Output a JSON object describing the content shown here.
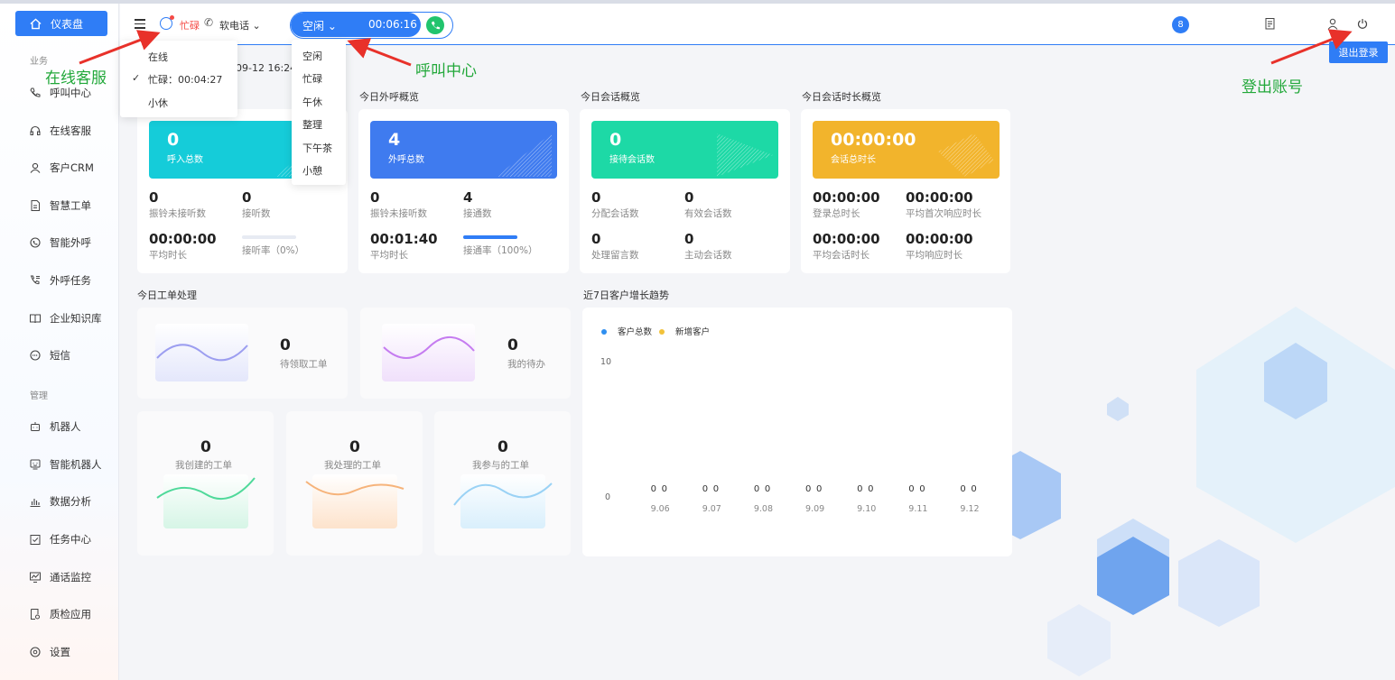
{
  "sidebar": {
    "dashboard_label": "仪表盘",
    "section_business": "业务",
    "section_manage": "管理",
    "business_items": [
      {
        "label": "呼叫中心",
        "icon": "phone-icon"
      },
      {
        "label": "在线客服",
        "icon": "headset-icon"
      },
      {
        "label": "客户CRM",
        "icon": "user-icon"
      },
      {
        "label": "智慧工单",
        "icon": "document-icon"
      },
      {
        "label": "智能外呼",
        "icon": "whatsapp-icon"
      },
      {
        "label": "外呼任务",
        "icon": "outbound-call-icon"
      },
      {
        "label": "企业知识库",
        "icon": "book-icon"
      },
      {
        "label": "短信",
        "icon": "sms-icon"
      }
    ],
    "manage_items": [
      {
        "label": "机器人",
        "icon": "robot-icon"
      },
      {
        "label": "智能机器人",
        "icon": "smart-robot-icon"
      },
      {
        "label": "数据分析",
        "icon": "bar-chart-icon"
      },
      {
        "label": "任务中心",
        "icon": "task-icon"
      },
      {
        "label": "通话监控",
        "icon": "monitor-icon"
      },
      {
        "label": "质检应用",
        "icon": "inspection-icon"
      },
      {
        "label": "设置",
        "icon": "settings-icon"
      }
    ]
  },
  "topbar": {
    "cs_status": "忙碌",
    "softphone_label": "软电话",
    "call_state": "空闲",
    "call_timer": "00:06:16",
    "notification_count": "8",
    "logout_label": "退出登录"
  },
  "cs_dropdown": {
    "items": [
      "在线",
      "忙碌：00:04:27",
      "小休"
    ],
    "checked_index": 1
  },
  "call_dropdown": {
    "items": [
      "空闲",
      "忙碌",
      "午休",
      "整理",
      "下午茶",
      "小憩"
    ]
  },
  "datetime_partial": "09-12 16:24",
  "cards": {
    "inbound": {
      "title": "",
      "hero_value": "0",
      "hero_label": "呼入总数",
      "color": "#15ccd9",
      "stats": [
        {
          "value": "0",
          "label": "振铃未接听数"
        },
        {
          "value": "0",
          "label": "接听数"
        },
        {
          "value": "00:00:00",
          "label": "平均时长"
        }
      ],
      "rate_label": "接听率（0%）",
      "rate": 0
    },
    "outbound": {
      "title": "今日外呼概览",
      "hero_value": "4",
      "hero_label": "外呼总数",
      "color": "#3f7bef",
      "stats": [
        {
          "value": "0",
          "label": "振铃未接听数"
        },
        {
          "value": "4",
          "label": "接通数"
        },
        {
          "value": "00:01:40",
          "label": "平均时长"
        }
      ],
      "rate_label": "接通率（100%）",
      "rate": 1
    },
    "session": {
      "title": "今日会话概览",
      "hero_value": "0",
      "hero_label": "接待会话数",
      "color": "#1dd9a6",
      "stats": [
        {
          "value": "0",
          "label": "分配会话数"
        },
        {
          "value": "0",
          "label": "有效会话数"
        },
        {
          "value": "0",
          "label": "处理留言数"
        },
        {
          "value": "0",
          "label": "主动会话数"
        }
      ]
    },
    "duration": {
      "title": "今日会话时长概览",
      "hero_value": "00:00:00",
      "hero_label": "会话总时长",
      "color": "#f2b42c",
      "stats": [
        {
          "value": "00:00:00",
          "label": "登录总时长"
        },
        {
          "value": "00:00:00",
          "label": "平均首次响应时长"
        },
        {
          "value": "00:00:00",
          "label": "平均会话时长"
        },
        {
          "value": "00:00:00",
          "label": "平均响应时长"
        }
      ]
    }
  },
  "workorders": {
    "title": "今日工单处理",
    "top": [
      {
        "value": "0",
        "label": "待领取工单"
      },
      {
        "value": "0",
        "label": "我的待办"
      }
    ],
    "bottom": [
      {
        "value": "0",
        "label": "我创建的工单"
      },
      {
        "value": "0",
        "label": "我处理的工单"
      },
      {
        "value": "0",
        "label": "我参与的工单"
      }
    ]
  },
  "chart_data": {
    "type": "bar",
    "title": "近7日客户增长趋势",
    "categories": [
      "9.06",
      "9.07",
      "9.08",
      "9.09",
      "9.10",
      "9.11",
      "9.12"
    ],
    "series": [
      {
        "name": "客户总数",
        "values": [
          0,
          0,
          0,
          0,
          0,
          0,
          0
        ],
        "color": "#2f8ff0"
      },
      {
        "name": "新增客户",
        "values": [
          0,
          0,
          0,
          0,
          0,
          0,
          0
        ],
        "color": "#f2c23a"
      }
    ],
    "ylim": [
      0,
      10
    ],
    "yticks": [
      "10",
      "0"
    ],
    "legend": "top-left",
    "grid": false
  },
  "annotations": {
    "online_cs": "在线客服",
    "call_center": "呼叫中心",
    "logout": "登出账号"
  }
}
